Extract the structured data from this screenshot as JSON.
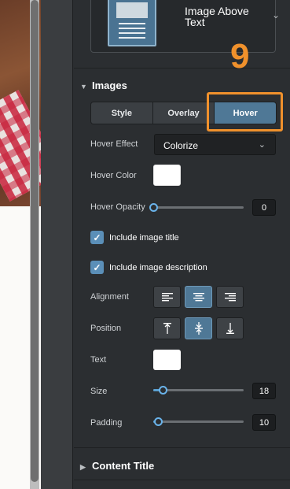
{
  "layout_picker": {
    "title": "Image Above Text"
  },
  "step_badge": "9",
  "images_section": {
    "title": "Images",
    "tabs": [
      {
        "label": "Style",
        "active": false
      },
      {
        "label": "Overlay",
        "active": false
      },
      {
        "label": "Hover",
        "active": true
      }
    ],
    "hover_effect": {
      "label": "Hover Effect",
      "value": "Colorize"
    },
    "hover_color": {
      "label": "Hover Color",
      "value": "#ffffff"
    },
    "hover_opacity": {
      "label": "Hover Opacity",
      "value": "0",
      "fraction": 0.0
    },
    "include_title": {
      "label": "Include image title",
      "checked": true
    },
    "include_description": {
      "label": "Include image description",
      "checked": true
    },
    "alignment": {
      "label": "Alignment",
      "selected": "center"
    },
    "position": {
      "label": "Position",
      "selected": "middle"
    },
    "text_color": {
      "label": "Text",
      "value": "#ffffff"
    },
    "size": {
      "label": "Size",
      "value": "18",
      "fraction": 0.1
    },
    "padding": {
      "label": "Padding",
      "value": "10",
      "fraction": 0.05
    }
  },
  "content_title_section": {
    "title": "Content Title"
  },
  "colors": {
    "accent": "#f0912c",
    "active_tab": "#4f7896",
    "slider": "#6ab3ea"
  }
}
